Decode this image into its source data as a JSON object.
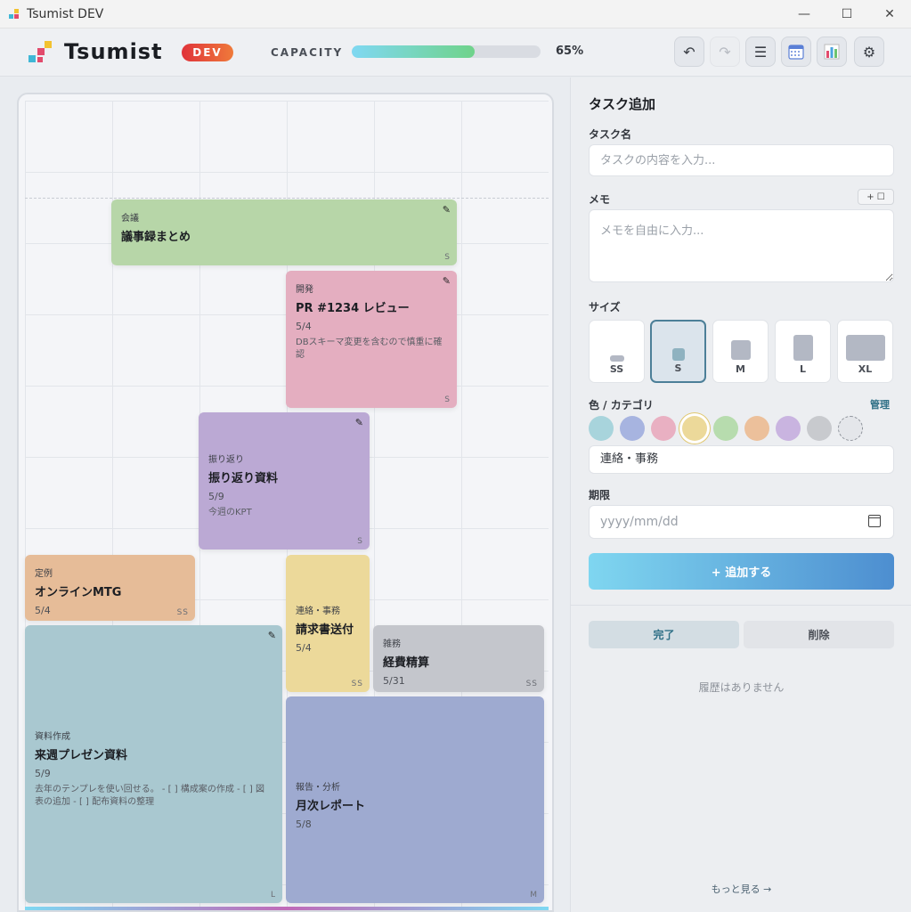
{
  "window": {
    "title": "Tsumist DEV"
  },
  "header": {
    "logo_text": "Tsumist",
    "badge": "DEV",
    "capacity_label": "CAPACITY",
    "capacity_percent": 65,
    "capacity_text": "65%"
  },
  "board": {
    "cards": [
      {
        "category": "会議",
        "name": "議事録まとめ",
        "due": "",
        "memo": "",
        "size": "S",
        "color": "#b7d6a8"
      },
      {
        "category": "開発",
        "name": "PR #1234 レビュー",
        "due": "5/4",
        "memo": "DBスキーマ変更を含むので慎重に確認",
        "size": "S",
        "color": "#e4aec0"
      },
      {
        "category": "振り返り",
        "name": "振り返り資料",
        "due": "5/9",
        "memo": "今週のKPT",
        "size": "S",
        "color": "#bba9d4"
      },
      {
        "category": "定例",
        "name": "オンラインMTG",
        "due": "5/4",
        "memo": "",
        "size": "SS",
        "color": "#e6bc98"
      },
      {
        "category": "連絡・事務",
        "name": "請求書送付",
        "due": "5/4",
        "memo": "",
        "size": "SS",
        "color": "#ecd99a"
      },
      {
        "category": "雑務",
        "name": "経費精算",
        "due": "5/31",
        "memo": "",
        "size": "SS",
        "color": "#c4c6cc"
      },
      {
        "category": "資料作成",
        "name": "来週プレゼン資料",
        "due": "5/9",
        "memo": "去年のテンプレを使い回せる。 - [ ] 構成案の作成 - [ ] 図表の追加 - [ ] 配布資料の整理",
        "size": "L",
        "color": "#a9c8d0"
      },
      {
        "category": "報告・分析",
        "name": "月次レポート",
        "due": "5/8",
        "memo": "",
        "size": "M",
        "color": "#9eaad0"
      }
    ]
  },
  "panel": {
    "title": "タスク追加",
    "task_name_label": "タスク名",
    "task_name_placeholder": "タスクの内容を入力...",
    "memo_label": "メモ",
    "memo_add_label": "+ ☐",
    "memo_placeholder": "メモを自由に入力...",
    "size_label": "サイズ",
    "sizes": [
      "SS",
      "S",
      "M",
      "L",
      "XL"
    ],
    "selected_size": "S",
    "color_label": "色 / カテゴリ",
    "manage_label": "管理",
    "swatches": [
      "#a8d4dc",
      "#a7b4e0",
      "#e9b0c2",
      "#ecd99a",
      "#b7dcae",
      "#ecc09b",
      "#c9b4e0",
      "#c8cace"
    ],
    "category_value": "連絡・事務",
    "due_label": "期限",
    "due_placeholder": "yyyy/mm/dd",
    "add_button": "+ 追加する",
    "done_tab": "完了",
    "delete_tab": "削除",
    "empty_history": "履歴はありません",
    "more_link": "もっと見る →"
  }
}
